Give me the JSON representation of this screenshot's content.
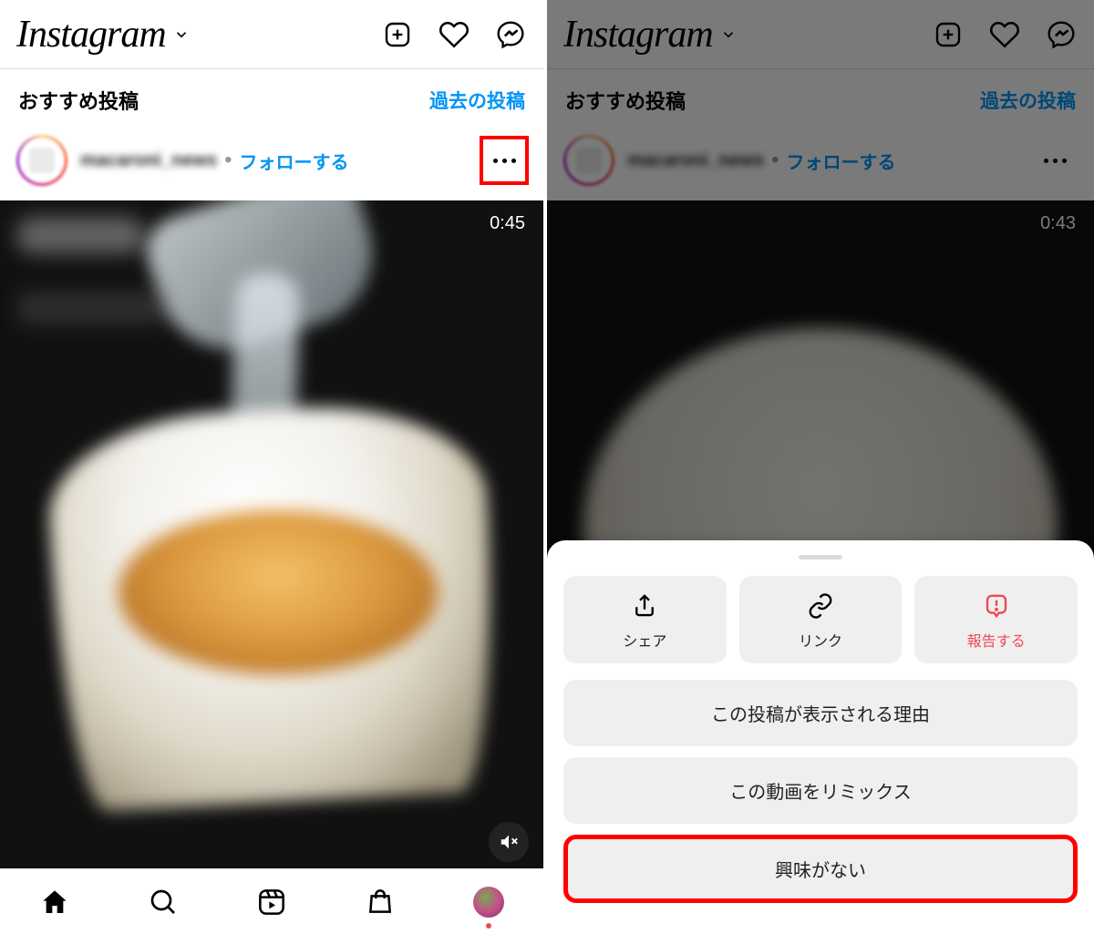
{
  "logo_text": "Instagram",
  "suggested": {
    "title": "おすすめ投稿",
    "link": "過去の投稿"
  },
  "post": {
    "username": "macaroni_news",
    "follow_label": "フォローする"
  },
  "left": {
    "video_time": "0:45"
  },
  "right": {
    "video_time": "0:43"
  },
  "sheet": {
    "actions": [
      {
        "label": "シェア"
      },
      {
        "label": "リンク"
      },
      {
        "label": "報告する"
      }
    ],
    "items": [
      "この投稿が表示される理由",
      "この動画をリミックス",
      "興味がない"
    ]
  }
}
